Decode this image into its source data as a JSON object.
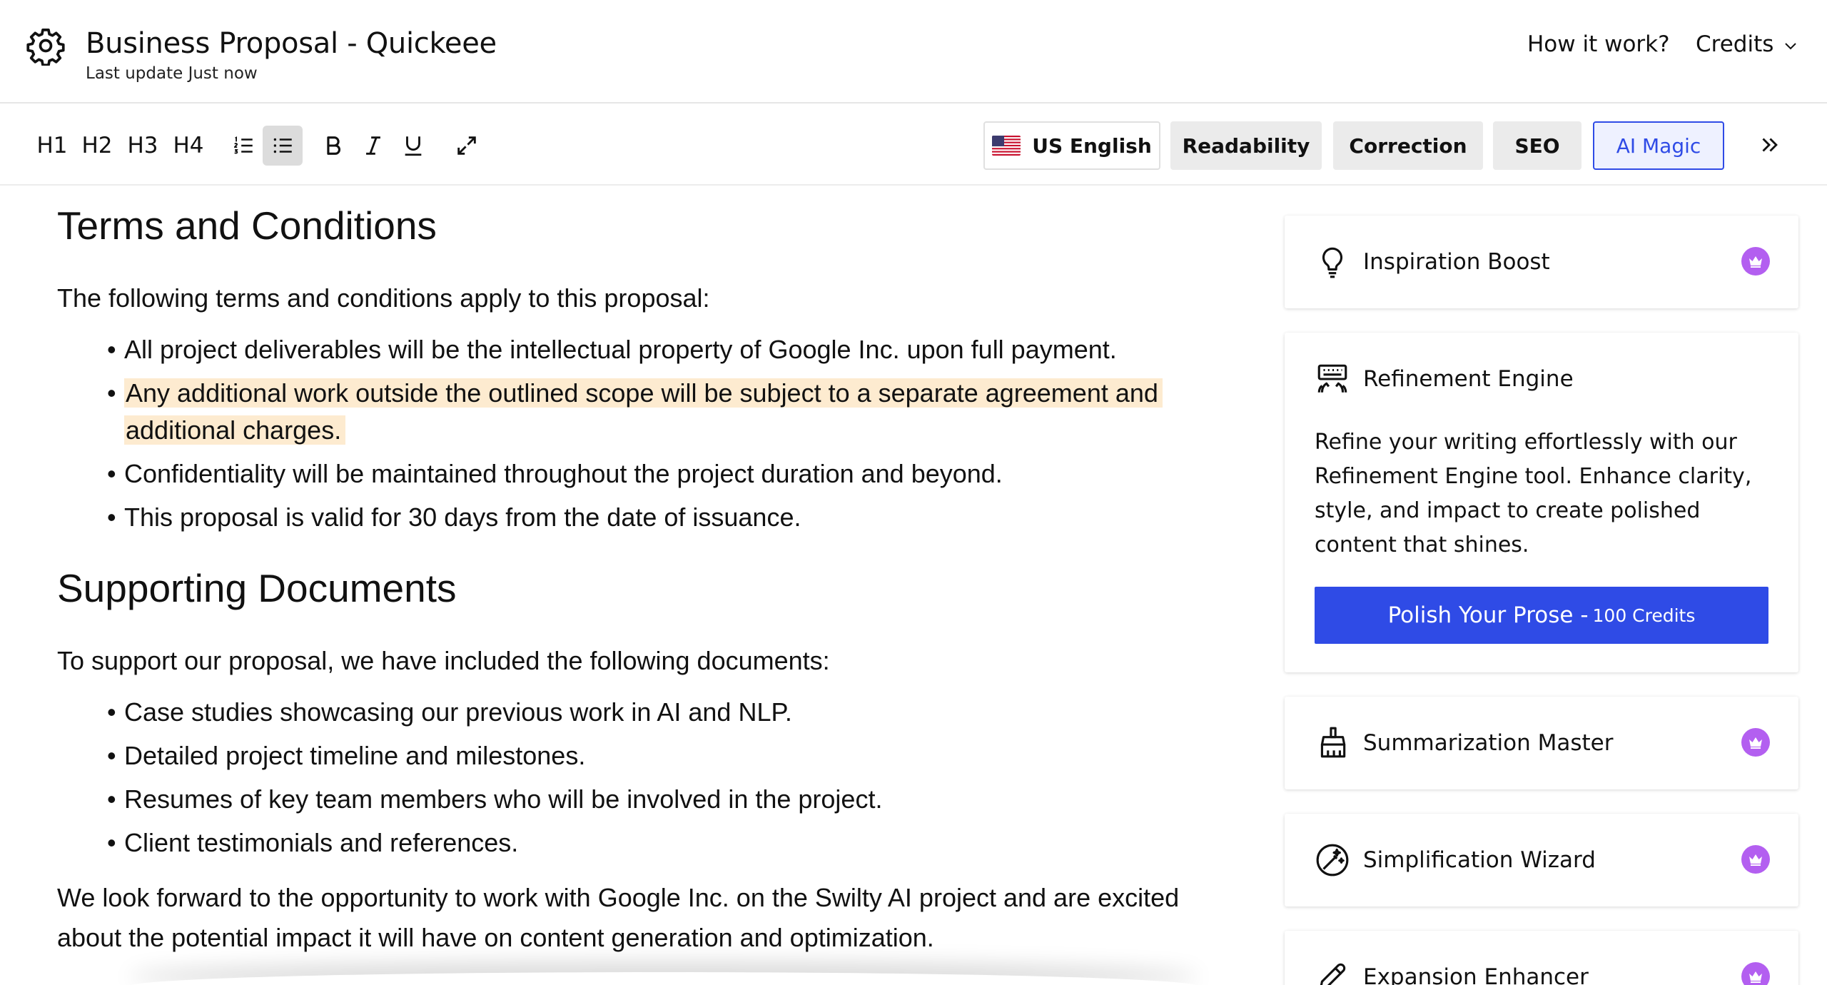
{
  "header": {
    "title": "Business Proposal - Quickeee",
    "last_update": "Last update Just now",
    "how_it_works": "How it work?",
    "credits": "Credits"
  },
  "toolbar": {
    "h1": "H1",
    "h2": "H2",
    "h3": "H3",
    "h4": "H4",
    "language": "US English",
    "tabs": [
      "Readability",
      "Correction",
      "SEO",
      "AI Magic"
    ],
    "active_tab": "AI Magic",
    "active_format": "bullet-list"
  },
  "document": {
    "terms_heading": "Terms and Conditions",
    "terms_intro": "The following terms and conditions apply to this proposal:",
    "terms_items": [
      "All project deliverables will be the intellectual property of Google Inc. upon full payment.",
      "Any additional work outside the outlined scope will be subject to a separate agreement and additional charges.",
      "Confidentiality will be maintained throughout the project duration and beyond.",
      "This proposal is valid for 30 days from the date of issuance."
    ],
    "highlighted_item": 1,
    "docs_heading": "Supporting Documents",
    "docs_intro": "To support our proposal, we have included the following documents:",
    "docs_items": [
      "Case studies showcasing our previous work in AI and NLP.",
      "Detailed project timeline and milestones.",
      "Resumes of key team members who will be involved in the project.",
      "Client testimonials and references."
    ],
    "closing": "We look forward to the opportunity to work with Google Inc. on the Swilty AI project and are excited about the potential impact it will have on content generation and optimization."
  },
  "panel": {
    "cards": [
      {
        "title": "Inspiration Boost",
        "icon": "lightbulb-icon",
        "premium": true
      },
      {
        "title": "Refinement Engine",
        "icon": "keyboard-hands-icon",
        "premium": false,
        "description": "Refine your writing effortlessly with our Refinement Engine tool. Enhance clarity, style, and impact to create polished content that shines.",
        "cta": "Polish Your Prose -",
        "cta_credits": "100 Credits"
      },
      {
        "title": "Summarization Master",
        "icon": "brush-icon",
        "premium": true
      },
      {
        "title": "Simplification Wizard",
        "icon": "magic-wand-icon",
        "premium": true
      },
      {
        "title": "Expansion Enhancer",
        "icon": "pencil-icon",
        "premium": true
      }
    ]
  },
  "colors": {
    "accent": "#2f4be6",
    "highlight": "#fdebd0",
    "premium_badge": "#b35ff0"
  }
}
